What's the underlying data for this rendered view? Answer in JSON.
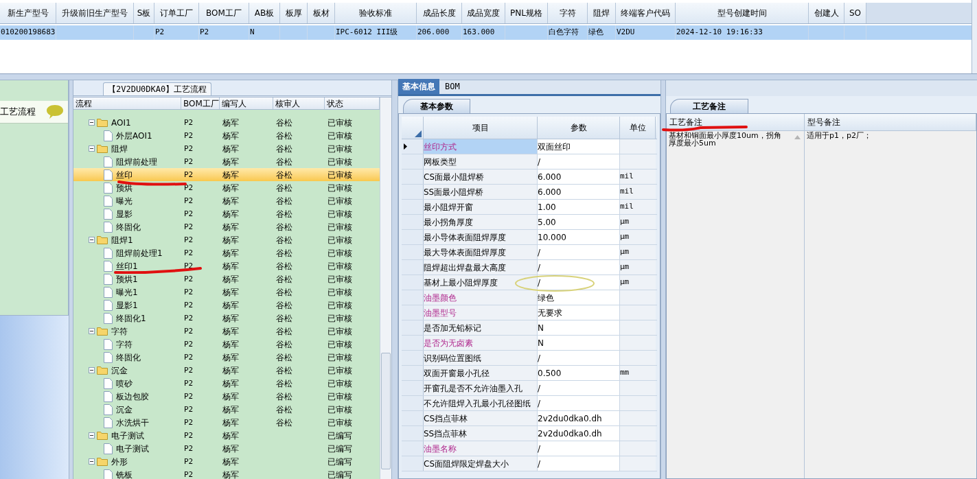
{
  "top_table": {
    "columns": [
      {
        "label": "新生产型号"
      },
      {
        "label": "升级前旧生产型号"
      },
      {
        "label": "S板"
      },
      {
        "label": "订单工厂"
      },
      {
        "label": "BOM工厂"
      },
      {
        "label": "AB板"
      },
      {
        "label": "板厚"
      },
      {
        "label": "板材"
      },
      {
        "label": "验收标准"
      },
      {
        "label": "成品长度"
      },
      {
        "label": "成品宽度"
      },
      {
        "label": "PNL规格"
      },
      {
        "label": "字符"
      },
      {
        "label": "阻焊"
      },
      {
        "label": "终端客户代码"
      },
      {
        "label": "型号创建时间"
      },
      {
        "label": "创建人"
      },
      {
        "label": "SO"
      }
    ],
    "rows": [
      {
        "selected": true,
        "cells": [
          "010200198683",
          null,
          null,
          "P2",
          "P2",
          "N",
          null,
          null,
          "IPC-6012 III级",
          "206.000",
          "163.000",
          null,
          "白色字符",
          "绿色",
          "V2DU",
          "2024-12-10 19:16:33",
          null,
          null
        ]
      }
    ]
  },
  "sidebar": {
    "items": [
      {
        "label": "工艺流程",
        "selected": true
      }
    ]
  },
  "flow_panel": {
    "title": "【2V2DU0DKA0】工艺流程",
    "columns": [
      "流程",
      "BOM工厂",
      "编写人",
      "核审人",
      "状态"
    ],
    "rows": [
      {
        "kind": "folder",
        "name": "AOI1",
        "factory": "P2",
        "writer": "杨军",
        "reviewer": "谷松",
        "status": "已审核",
        "selected": false,
        "expanded": true,
        "children": [
          {
            "kind": "file",
            "name": "外层AOI1",
            "factory": "P2",
            "writer": "杨军",
            "reviewer": "谷松",
            "status": "已审核",
            "selected": false
          }
        ]
      },
      {
        "kind": "folder",
        "name": "阻焊",
        "factory": "P2",
        "writer": "杨军",
        "reviewer": "谷松",
        "status": "已审核",
        "selected": false,
        "expanded": true,
        "children": [
          {
            "kind": "file",
            "name": "阻焊前处理",
            "factory": "P2",
            "writer": "杨军",
            "reviewer": "谷松",
            "status": "已审核",
            "selected": false
          },
          {
            "kind": "file",
            "name": "丝印",
            "factory": "P2",
            "writer": "杨军",
            "reviewer": "谷松",
            "status": "已审核",
            "selected": true
          },
          {
            "kind": "file",
            "name": "预烘",
            "factory": "P2",
            "writer": "杨军",
            "reviewer": "谷松",
            "status": "已审核",
            "selected": false
          },
          {
            "kind": "file",
            "name": "曝光",
            "factory": "P2",
            "writer": "杨军",
            "reviewer": "谷松",
            "status": "已审核",
            "selected": false
          },
          {
            "kind": "file",
            "name": "显影",
            "factory": "P2",
            "writer": "杨军",
            "reviewer": "谷松",
            "status": "已审核",
            "selected": false
          },
          {
            "kind": "file",
            "name": "终固化",
            "factory": "P2",
            "writer": "杨军",
            "reviewer": "谷松",
            "status": "已审核",
            "selected": false
          }
        ]
      },
      {
        "kind": "folder",
        "name": "阻焊1",
        "factory": "P2",
        "writer": "杨军",
        "reviewer": "谷松",
        "status": "已审核",
        "selected": false,
        "expanded": true,
        "children": [
          {
            "kind": "file",
            "name": "阻焊前处理1",
            "factory": "P2",
            "writer": "杨军",
            "reviewer": "谷松",
            "status": "已审核",
            "selected": false
          },
          {
            "kind": "file",
            "name": "丝印1",
            "factory": "P2",
            "writer": "杨军",
            "reviewer": "谷松",
            "status": "已审核",
            "selected": false
          },
          {
            "kind": "file",
            "name": "预烘1",
            "factory": "P2",
            "writer": "杨军",
            "reviewer": "谷松",
            "status": "已审核",
            "selected": false
          },
          {
            "kind": "file",
            "name": "曝光1",
            "factory": "P2",
            "writer": "杨军",
            "reviewer": "谷松",
            "status": "已审核",
            "selected": false
          },
          {
            "kind": "file",
            "name": "显影1",
            "factory": "P2",
            "writer": "杨军",
            "reviewer": "谷松",
            "status": "已审核",
            "selected": false
          },
          {
            "kind": "file",
            "name": "终固化1",
            "factory": "P2",
            "writer": "杨军",
            "reviewer": "谷松",
            "status": "已审核",
            "selected": false
          }
        ]
      },
      {
        "kind": "folder",
        "name": "字符",
        "factory": "P2",
        "writer": "杨军",
        "reviewer": "谷松",
        "status": "已审核",
        "selected": false,
        "expanded": true,
        "children": [
          {
            "kind": "file",
            "name": "字符",
            "factory": "P2",
            "writer": "杨军",
            "reviewer": "谷松",
            "status": "已审核",
            "selected": false
          },
          {
            "kind": "file",
            "name": "终固化",
            "factory": "P2",
            "writer": "杨军",
            "reviewer": "谷松",
            "status": "已审核",
            "selected": false
          }
        ]
      },
      {
        "kind": "folder",
        "name": "沉金",
        "factory": "P2",
        "writer": "杨军",
        "reviewer": "谷松",
        "status": "已审核",
        "selected": false,
        "expanded": true,
        "children": [
          {
            "kind": "file",
            "name": "喷砂",
            "factory": "P2",
            "writer": "杨军",
            "reviewer": "谷松",
            "status": "已审核",
            "selected": false
          },
          {
            "kind": "file",
            "name": "板边包胶",
            "factory": "P2",
            "writer": "杨军",
            "reviewer": "谷松",
            "status": "已审核",
            "selected": false
          },
          {
            "kind": "file",
            "name": "沉金",
            "factory": "P2",
            "writer": "杨军",
            "reviewer": "谷松",
            "status": "已审核",
            "selected": false
          },
          {
            "kind": "file",
            "name": "水洗烘干",
            "factory": "P2",
            "writer": "杨军",
            "reviewer": "谷松",
            "status": "已审核",
            "selected": false
          }
        ]
      },
      {
        "kind": "folder",
        "name": "电子测试",
        "factory": "P2",
        "writer": "杨军",
        "status": "已编写",
        "selected": false,
        "expanded": true,
        "children": [
          {
            "kind": "file",
            "name": "电子测试",
            "factory": "P2",
            "writer": "杨军",
            "status": "已编写",
            "selected": false
          }
        ]
      },
      {
        "kind": "folder",
        "name": "外形",
        "factory": "P2",
        "writer": "杨军",
        "status": "已编写",
        "selected": false,
        "expanded": true,
        "children": [
          {
            "kind": "file",
            "name": "铣板",
            "factory": "P2",
            "writer": "杨军",
            "status": "已编写",
            "selected": false
          }
        ]
      }
    ]
  },
  "info_tabs": [
    {
      "label": "基本信息",
      "selected": true
    },
    {
      "label": "BOM",
      "selected": false
    }
  ],
  "params_panel": {
    "tab": "基本参数",
    "columns": [
      "项目",
      "参数",
      "单位"
    ],
    "rows": [
      {
        "item": "丝印方式",
        "value": "双面丝印",
        "emphasized": true,
        "selected": true
      },
      {
        "item": "网板类型",
        "value": "/",
        "emphasized": false,
        "selected": false
      },
      {
        "item": "CS面最小阻焊桥",
        "value": "6.000",
        "unit": "mil",
        "emphasized": false,
        "selected": false
      },
      {
        "item": "SS面最小阻焊桥",
        "value": "6.000",
        "unit": "mil",
        "emphasized": false,
        "selected": false
      },
      {
        "item": "最小阻焊开窗",
        "value": "1.00",
        "unit": "mil",
        "emphasized": false,
        "selected": false
      },
      {
        "item": "最小拐角厚度",
        "value": "5.00",
        "unit": "μm",
        "emphasized": false,
        "selected": false
      },
      {
        "item": "最小导体表面阻焊厚度",
        "value": "10.000",
        "unit": "μm",
        "emphasized": false,
        "selected": false
      },
      {
        "item": "最大导体表面阻焊厚度",
        "value": "/",
        "unit": "μm",
        "emphasized": false,
        "selected": false
      },
      {
        "item": "阻焊超出焊盘最大高度",
        "value": "/",
        "unit": "μm",
        "emphasized": false,
        "selected": false
      },
      {
        "item": "基材上最小阻焊厚度",
        "value": "/",
        "unit": "μm",
        "emphasized": false,
        "selected": false
      },
      {
        "item": "油墨颜色",
        "value": "绿色",
        "emphasized": true,
        "selected": false
      },
      {
        "item": "油墨型号",
        "value": "无要求",
        "emphasized": true,
        "selected": false
      },
      {
        "item": "是否加无铅标记",
        "value": "N",
        "emphasized": false,
        "selected": false
      },
      {
        "item": "是否为无卤素",
        "value": "N",
        "emphasized": true,
        "selected": false
      },
      {
        "item": "识别码位置图纸",
        "value": "/",
        "emphasized": false,
        "selected": false
      },
      {
        "item": "双面开窗最小孔径",
        "value": "0.500",
        "unit": "mm",
        "emphasized": false,
        "selected": false
      },
      {
        "item": "开窗孔是否不允许油墨入孔",
        "value": "/",
        "emphasized": false,
        "selected": false
      },
      {
        "item": "不允许阻焊入孔最小孔径图纸",
        "value": "/",
        "emphasized": false,
        "selected": false
      },
      {
        "item": "CS挡点菲林",
        "value": "2v2du0dka0.dh",
        "emphasized": false,
        "selected": false
      },
      {
        "item": "SS挡点菲林",
        "value": "2v2du0dka0.dh",
        "emphasized": false,
        "selected": false
      },
      {
        "item": "油墨名称",
        "value": "/",
        "emphasized": true,
        "selected": false
      },
      {
        "item": "CS面阻焊限定焊盘大小",
        "value": "/",
        "emphasized": false,
        "selected": false
      }
    ]
  },
  "notes_panel": {
    "tab": "工艺备注",
    "columns": [
      "工艺备注",
      "型号备注"
    ],
    "process_note": "基材和铜面最小厚度10um，拐角厚度最小5um",
    "model_note": "适用于p1，p2厂；"
  }
}
